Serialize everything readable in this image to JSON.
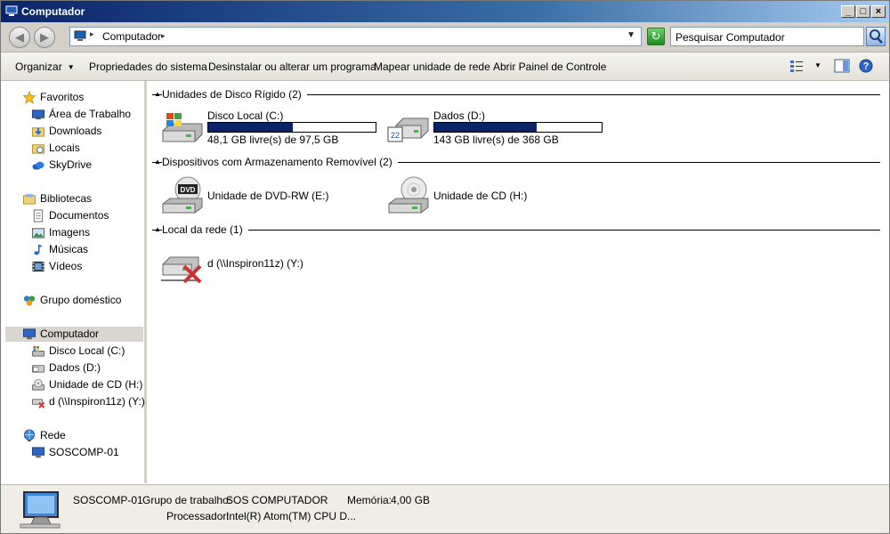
{
  "window": {
    "title": "Computador"
  },
  "nav": {
    "address": "Computador",
    "search_placeholder": "Pesquisar Computador"
  },
  "toolbar": {
    "organize": "Organizar",
    "system_properties": "Propriedades do sistema",
    "uninstall": "Desinstalar ou alterar um programa",
    "map_drive": "Mapear unidade de rede",
    "control_panel": "Abrir Painel de Controle"
  },
  "sidebar": {
    "favorites": {
      "label": "Favoritos",
      "items": [
        "Área de Trabalho",
        "Downloads",
        "Locais",
        "SkyDrive"
      ]
    },
    "libraries": {
      "label": "Bibliotecas",
      "items": [
        "Documentos",
        "Imagens",
        "Músicas",
        "Vídeos"
      ]
    },
    "homegroup": "Grupo doméstico",
    "computer": {
      "label": "Computador",
      "items": [
        "Disco Local (C:)",
        "Dados (D:)",
        "Unidade de CD (H:)",
        "d (\\\\Inspiron11z) (Y:)"
      ]
    },
    "network": {
      "label": "Rede",
      "items": [
        "SOSCOMP-01"
      ]
    }
  },
  "groups": {
    "hdd": {
      "label": "Unidades de Disco Rígido (2)",
      "drives": [
        {
          "name": "Disco Local (C:)",
          "free": "48,1 GB livre(s) de 97,5 GB",
          "used_fraction": 0.507
        },
        {
          "name": "Dados (D:)",
          "free": "143 GB livre(s) de 368 GB",
          "used_fraction": 0.611
        }
      ]
    },
    "removable": {
      "label": "Dispositivos com Armazenamento Removível (2)",
      "drives": [
        {
          "name": "Unidade de DVD-RW (E:)"
        },
        {
          "name": "Unidade de CD (H:)"
        }
      ]
    },
    "network": {
      "label": "Local da rede (1)",
      "drives": [
        {
          "name": "d (\\\\Inspiron11z) (Y:)"
        }
      ]
    }
  },
  "details": {
    "name": "SOSCOMP-01",
    "workgroup_label": "Grupo de trabalho:",
    "workgroup": "SOS COMPUTADOR",
    "memory_label": "Memória:",
    "memory": "4,00 GB",
    "processor_label": "Processador:",
    "processor": "Intel(R) Atom(TM) CPU D..."
  },
  "icons": {
    "dvd_label": "DVD",
    "hdd_d_label": "22"
  }
}
